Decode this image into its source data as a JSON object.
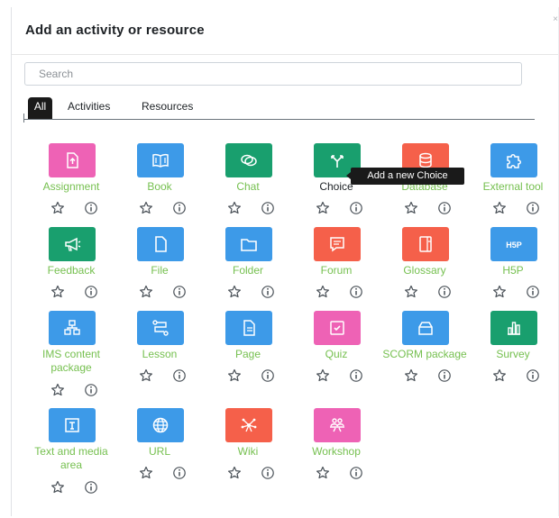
{
  "modal": {
    "title": "Add an activity or resource",
    "close_symbol": "×"
  },
  "search": {
    "placeholder": "Search",
    "value": ""
  },
  "tabs": [
    {
      "label": "All",
      "active": true
    },
    {
      "label": "Activities",
      "active": false
    },
    {
      "label": "Resources",
      "active": false
    }
  ],
  "tooltip": {
    "text": "Add a new Choice"
  },
  "colors": {
    "assessment": "#f062b3",
    "content": "#3d9ae8",
    "collaboration": "#15a069",
    "communication": "#f5604a",
    "interactive": "#3d9ae8",
    "label": "#76c050",
    "tab_active": "#1a1a1a"
  },
  "items": [
    {
      "label": "Assignment",
      "icon": "assignment-icon",
      "color": "#ee62b5"
    },
    {
      "label": "Book",
      "icon": "book-icon",
      "color": "#3d9ae8"
    },
    {
      "label": "Chat",
      "icon": "chat-icon",
      "color": "#199f6e"
    },
    {
      "label": "Choice",
      "icon": "choice-icon",
      "color": "#199f6e"
    },
    {
      "label": "Database",
      "icon": "database-icon",
      "color": "#f5604a"
    },
    {
      "label": "External tool",
      "icon": "puzzle-icon",
      "color": "#3d9ae8"
    },
    {
      "label": "Feedback",
      "icon": "megaphone-icon",
      "color": "#199f6e"
    },
    {
      "label": "File",
      "icon": "file-icon",
      "color": "#3d9ae8"
    },
    {
      "label": "Folder",
      "icon": "folder-icon",
      "color": "#3d9ae8"
    },
    {
      "label": "Forum",
      "icon": "forum-icon",
      "color": "#f5604a"
    },
    {
      "label": "Glossary",
      "icon": "glossary-icon",
      "color": "#f5604a"
    },
    {
      "label": "H5P",
      "icon": "h5p-icon",
      "color": "#3d9ae8"
    },
    {
      "label": "IMS content package",
      "icon": "package-icon",
      "color": "#3d9ae8"
    },
    {
      "label": "Lesson",
      "icon": "lesson-icon",
      "color": "#3d9ae8"
    },
    {
      "label": "Page",
      "icon": "page-icon",
      "color": "#3d9ae8"
    },
    {
      "label": "Quiz",
      "icon": "quiz-icon",
      "color": "#ee62b5"
    },
    {
      "label": "SCORM package",
      "icon": "scorm-icon",
      "color": "#3d9ae8"
    },
    {
      "label": "Survey",
      "icon": "survey-icon",
      "color": "#199f6e"
    },
    {
      "label": "Text and media area",
      "icon": "text-media-icon",
      "color": "#3d9ae8"
    },
    {
      "label": "URL",
      "icon": "globe-icon",
      "color": "#3d9ae8"
    },
    {
      "label": "Wiki",
      "icon": "wiki-icon",
      "color": "#f5604a"
    },
    {
      "label": "Workshop",
      "icon": "workshop-icon",
      "color": "#ee62b5"
    }
  ]
}
